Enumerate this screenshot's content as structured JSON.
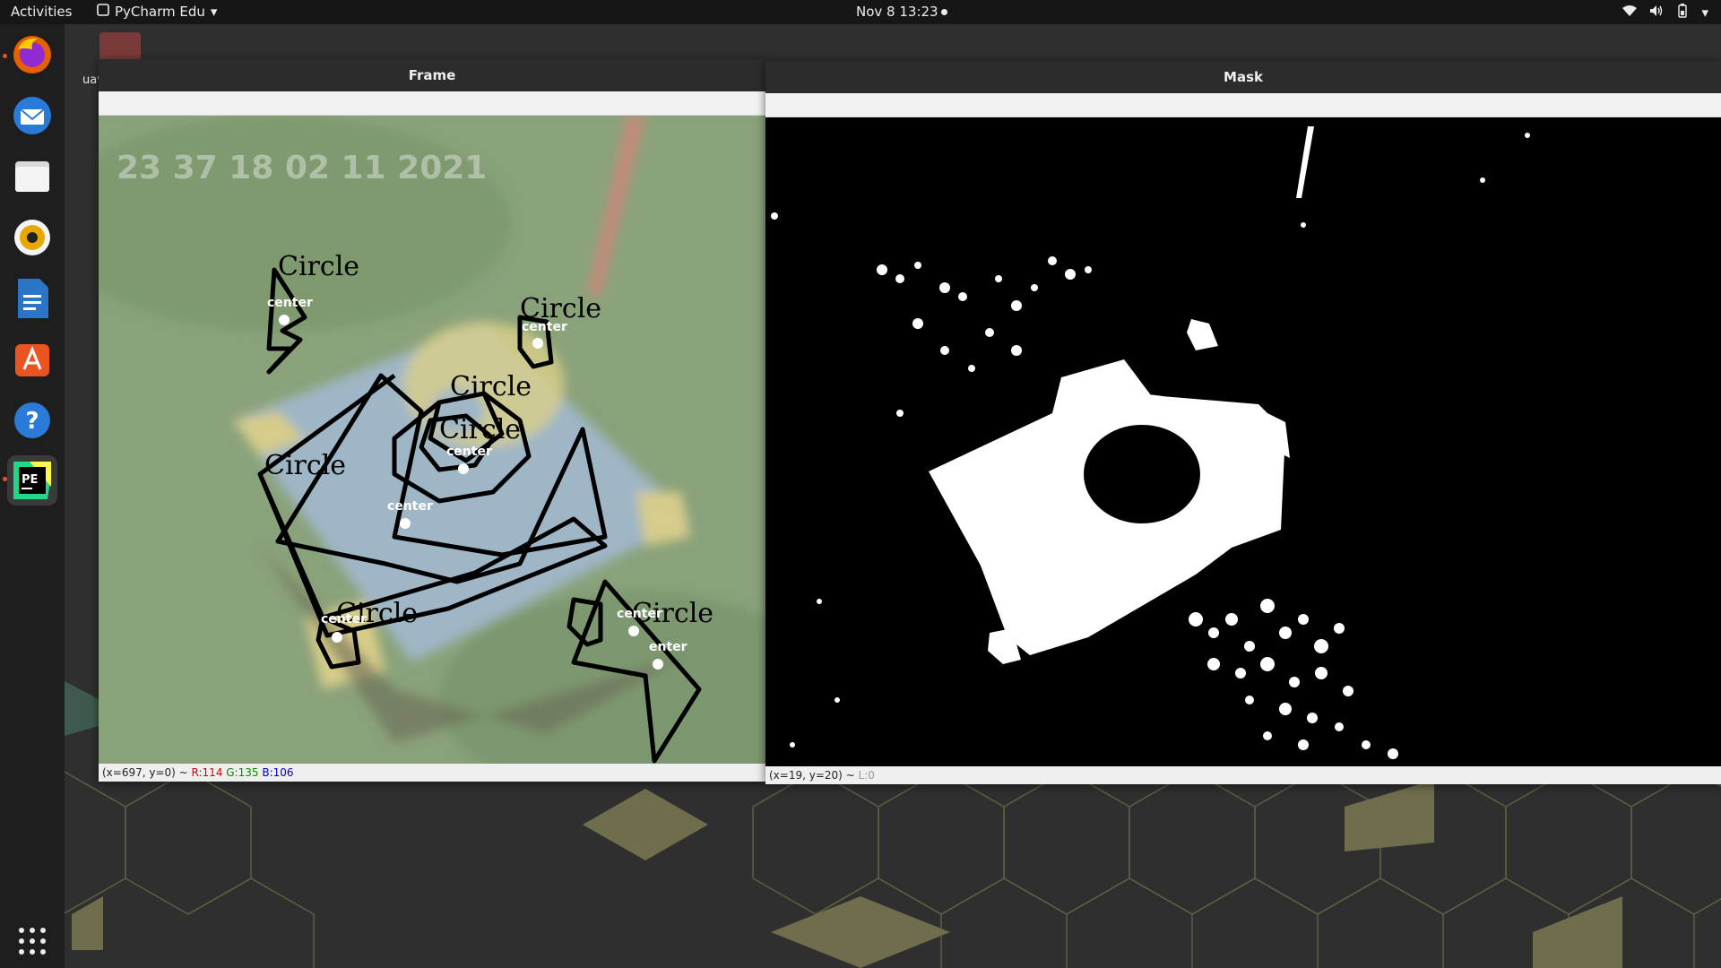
{
  "topbar": {
    "activities": "Activities",
    "app_name": "PyCharm Edu",
    "clock": "Nov 8  13:23"
  },
  "desktop": {
    "folder_label": "uav"
  },
  "dock": {
    "items": [
      "firefox-icon",
      "thunderbird-icon",
      "files-icon",
      "rhythmbox-icon",
      "libreoffice-writer-icon",
      "software-center-icon",
      "help-icon",
      "pycharm-edu-icon"
    ]
  },
  "frame_window": {
    "title": "Frame",
    "timestamp_overlay": "23 37 18 02 11 2021",
    "shape_labels": [
      "Circle",
      "Circle",
      "Circle",
      "Circle",
      "Circle",
      "Circle",
      "Circle"
    ],
    "center_labels": [
      "center",
      "center",
      "center",
      "center",
      "center",
      "center",
      "enter"
    ],
    "status_coords": "(x=697, y=0) ~ ",
    "status_r": "R:114",
    "status_g": "G:135",
    "status_b": "B:106"
  },
  "mask_window": {
    "title": "Mask",
    "status_coords": "(x=19, y=20) ~ ",
    "status_l": "L:0"
  }
}
